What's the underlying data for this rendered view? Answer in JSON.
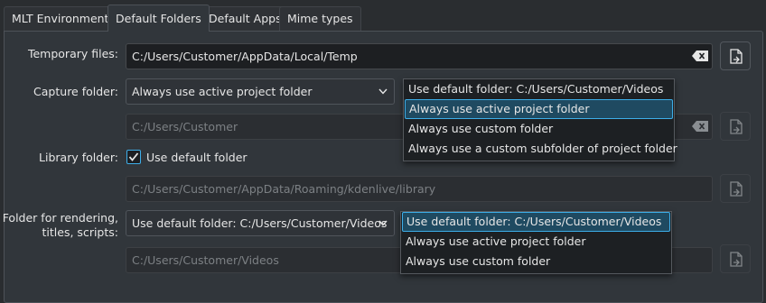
{
  "tabs": [
    {
      "label": "MLT Environment"
    },
    {
      "label": "Default Folders"
    },
    {
      "label": "Default Apps"
    },
    {
      "label": "Mime types"
    }
  ],
  "temporary": {
    "label": "Temporary files:",
    "value": "C:/Users/Customer/AppData/Local/Temp"
  },
  "capture": {
    "label": "Capture folder:",
    "selected": "Always use active project folder",
    "custom_path": "C:/Users/Customer",
    "options": [
      "Use default folder: C:/Users/Customer/Videos",
      "Always use active project folder",
      "Always use custom folder",
      "Always use a custom subfolder of project folder"
    ],
    "highlighted": "Always use active project folder"
  },
  "library": {
    "label": "Library folder:",
    "checkbox_label": "Use default folder",
    "checked": true,
    "path": "C:/Users/Customer/AppData/Roaming/kdenlive/library"
  },
  "rendering": {
    "label_line1": "Folder for rendering,",
    "label_line2": "titles, scripts:",
    "selected": "Use default folder: C:/Users/Customer/Videos",
    "path": "C:/Users/Customer/Videos",
    "options": [
      "Use default folder: C:/Users/Customer/Videos",
      "Always use active project folder",
      "Always use custom folder"
    ],
    "highlighted": "Use default folder: C:/Users/Customer/Videos"
  },
  "icons": {
    "clear": "clear-text-icon",
    "open_file": "open-file-icon",
    "chevron": "chevron-down-icon",
    "check": "checkmark-icon"
  },
  "colors": {
    "accent": "#3daee9",
    "background": "#31363b",
    "highlight": "#1f4a61"
  }
}
